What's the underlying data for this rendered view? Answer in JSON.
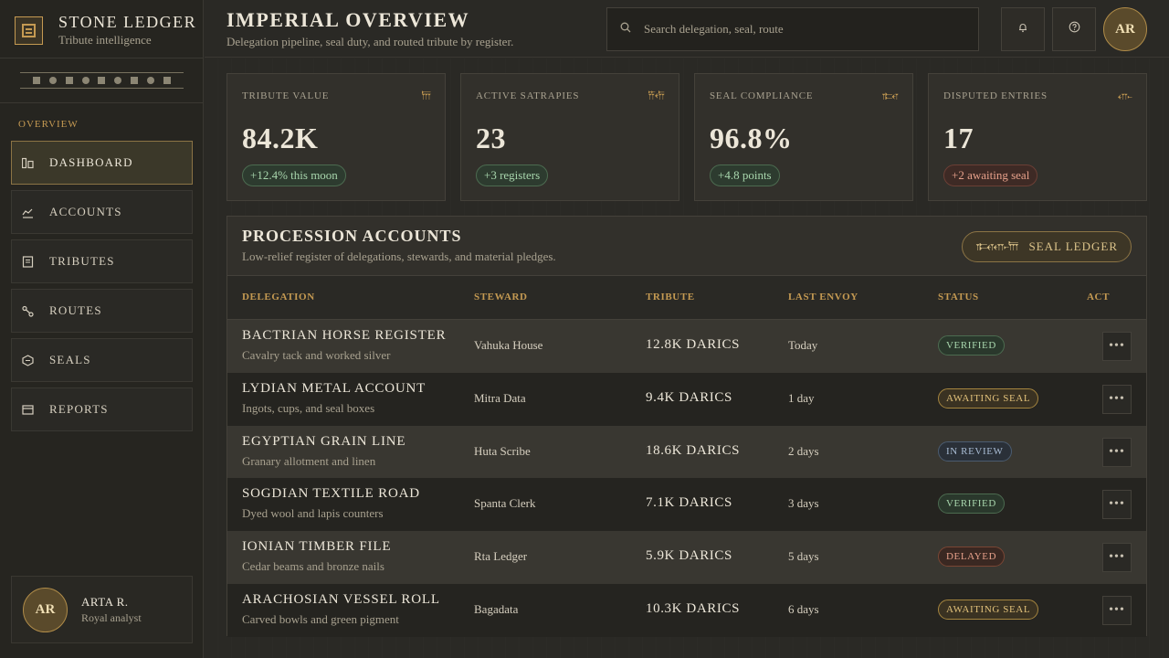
{
  "brand": {
    "title": "STONE LEDGER",
    "subtitle": "Tribute intelligence"
  },
  "sidebar": {
    "section_label": "OVERVIEW",
    "items": [
      {
        "label": "DASHBOARD",
        "icon": "dashboard-icon",
        "active": true
      },
      {
        "label": "ACCOUNTS",
        "icon": "chart-line-icon"
      },
      {
        "label": "TRIBUTES",
        "icon": "document-icon"
      },
      {
        "label": "ROUTES",
        "icon": "route-icon"
      },
      {
        "label": "SEALS",
        "icon": "seal-icon"
      },
      {
        "label": "REPORTS",
        "icon": "card-icon"
      }
    ],
    "profile": {
      "initials": "AR",
      "name": "ARTA R.",
      "role": "Royal analyst"
    }
  },
  "header": {
    "title": "IMPERIAL OVERVIEW",
    "subtitle": "Delegation pipeline, seal duty, and routed tribute by register.",
    "search_placeholder": "Search delegation, seal, route",
    "avatar_initials": "AR"
  },
  "stats": [
    {
      "label": "TRIBUTE VALUE",
      "value": "84.2K",
      "badge": "+12.4% this moon",
      "tone": "green",
      "glyph": "𐎠"
    },
    {
      "label": "ACTIVE SATRAPIES",
      "value": "23",
      "badge": "+3 registers",
      "tone": "green",
      "glyph": "𐎡𐎢"
    },
    {
      "label": "SEAL COMPLIANCE",
      "value": "96.8%",
      "badge": "+4.8 points",
      "tone": "green",
      "glyph": "𐎣𐎤"
    },
    {
      "label": "DISPUTED ENTRIES",
      "value": "17",
      "badge": "+2 awaiting seal",
      "tone": "red",
      "glyph": "𐎥"
    }
  ],
  "accounts": {
    "title": "PROCESSION ACCOUNTS",
    "subtitle": "Low-relief register of delegations, stewards, and material pledges.",
    "seal_button": "SEAL LEDGER",
    "seal_glyphs": "𐎣𐎤𐎥𐎠",
    "columns": [
      "DELEGATION",
      "STEWARD",
      "TRIBUTE",
      "LAST ENVOY",
      "STATUS",
      "ACT"
    ],
    "rows": [
      {
        "name": "BACTRIAN HORSE REGISTER",
        "desc": "Cavalry tack and worked silver",
        "steward": "Vahuka House",
        "tribute": "12.8K DARICS",
        "envoy": "Today",
        "status": "VERIFIED",
        "status_type": "verified",
        "act": "•••"
      },
      {
        "name": "LYDIAN METAL ACCOUNT",
        "desc": "Ingots, cups, and seal boxes",
        "steward": "Mitra Data",
        "tribute": "9.4K DARICS",
        "envoy": "1 day",
        "status": "AWAITING SEAL",
        "status_type": "awaiting",
        "act": "•••"
      },
      {
        "name": "EGYPTIAN GRAIN LINE",
        "desc": "Granary allotment and linen",
        "steward": "Huta Scribe",
        "tribute": "18.6K DARICS",
        "envoy": "2 days",
        "status": "IN REVIEW",
        "status_type": "review",
        "act": "•••"
      },
      {
        "name": "SOGDIAN TEXTILE ROAD",
        "desc": "Dyed wool and lapis counters",
        "steward": "Spanta Clerk",
        "tribute": "7.1K DARICS",
        "envoy": "3 days",
        "status": "VERIFIED",
        "status_type": "verified",
        "act": "•••"
      },
      {
        "name": "IONIAN TIMBER FILE",
        "desc": "Cedar beams and bronze nails",
        "steward": "Rta Ledger",
        "tribute": "5.9K DARICS",
        "envoy": "5 days",
        "status": "DELAYED",
        "status_type": "delayed",
        "act": "•••"
      },
      {
        "name": "ARACHOSIAN VESSEL ROLL",
        "desc": "Carved bowls and green pigment",
        "steward": "Bagadata",
        "tribute": "10.3K DARICS",
        "envoy": "6 days",
        "status": "AWAITING SEAL",
        "status_type": "awaiting",
        "act": "•••"
      }
    ]
  },
  "colors": {
    "accent": "#c59a52",
    "background": "#2a2925",
    "panel": "#32302b"
  }
}
